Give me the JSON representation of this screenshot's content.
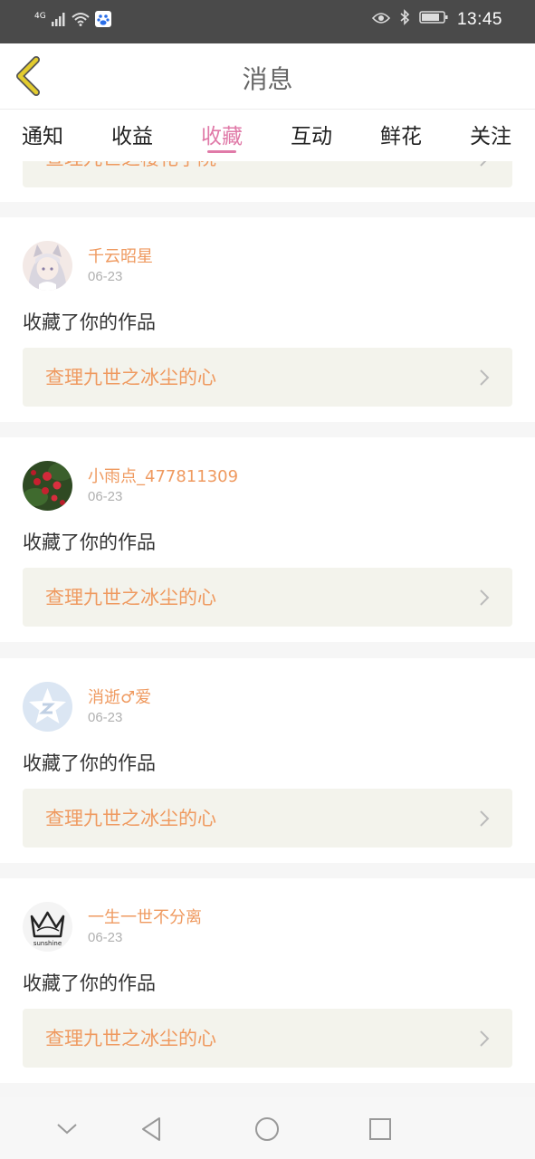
{
  "status": {
    "network": "4G",
    "time": "13:45"
  },
  "header": {
    "title": "消息"
  },
  "tabs": [
    {
      "label": "通知",
      "active": false
    },
    {
      "label": "收益",
      "active": false
    },
    {
      "label": "收藏",
      "active": true
    },
    {
      "label": "互动",
      "active": false
    },
    {
      "label": "鲜花",
      "active": false
    },
    {
      "label": "关注",
      "active": false
    }
  ],
  "partial_item": {
    "work": "查理九世之樱花学院"
  },
  "items": [
    {
      "user": "千云昭星",
      "date": "06-23",
      "action": "收藏了你的作品",
      "work": "查理九世之冰尘的心"
    },
    {
      "user": "小雨点_477811309",
      "date": "06-23",
      "action": "收藏了你的作品",
      "work": "查理九世之冰尘的心"
    },
    {
      "user": "消逝♂爱",
      "date": "06-23",
      "action": "收藏了你的作品",
      "work": "查理九世之冰尘的心"
    },
    {
      "user": "一生一世不分离",
      "date": "06-23",
      "action": "收藏了你的作品",
      "work": "查理九世之冰尘的心"
    }
  ],
  "avatar_text": {
    "sunshine": "sunshine"
  },
  "colors": {
    "accent": "#e07aa8",
    "link": "#ef9a60",
    "back_arrow": "#c9b400"
  }
}
